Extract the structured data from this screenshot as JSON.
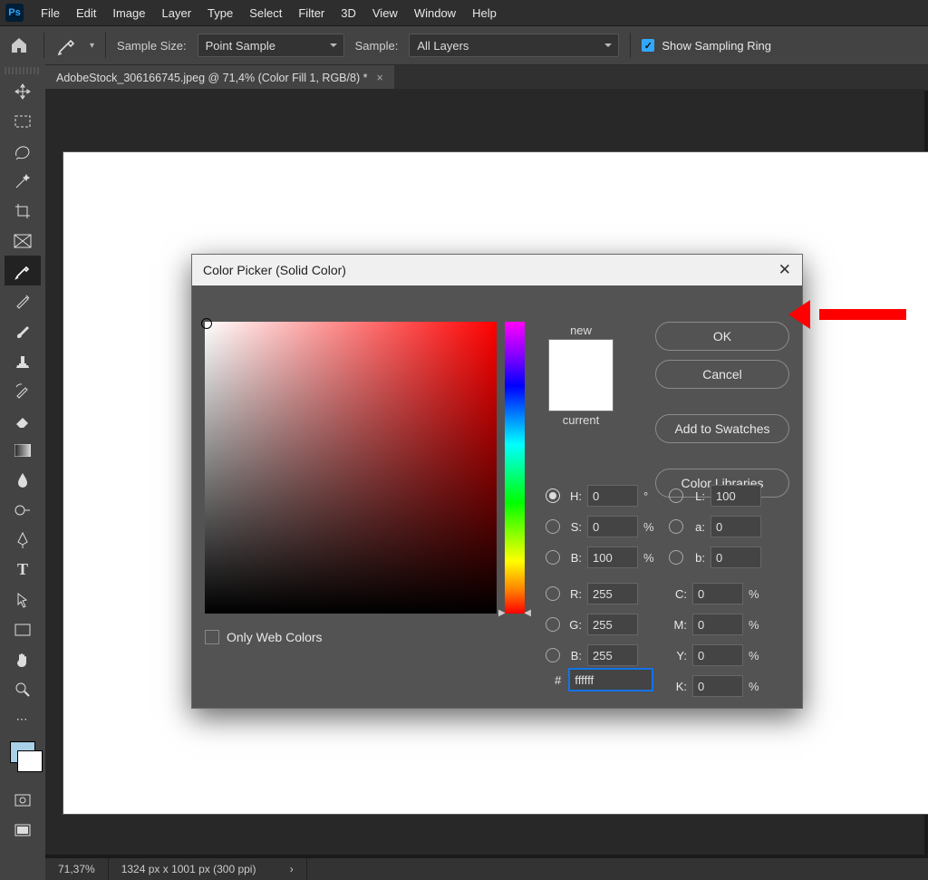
{
  "app": {
    "logo": "Ps"
  },
  "menu": [
    "File",
    "Edit",
    "Image",
    "Layer",
    "Type",
    "Select",
    "Filter",
    "3D",
    "View",
    "Window",
    "Help"
  ],
  "options": {
    "sample_size_label": "Sample Size:",
    "sample_size_value": "Point Sample",
    "sample_label": "Sample:",
    "sample_value": "All Layers",
    "ring_label": "Show Sampling Ring"
  },
  "tab": {
    "title": "AdobeStock_306166745.jpeg @ 71,4% (Color Fill 1, RGB/8) *",
    "close": "×"
  },
  "status": {
    "zoom": "71,37%",
    "docinfo": "1324 px x 1001 px (300 ppi)"
  },
  "dialog": {
    "title": "Color Picker (Solid Color)",
    "new_label": "new",
    "current_label": "current",
    "ok": "OK",
    "cancel": "Cancel",
    "add_swatch": "Add to Swatches",
    "color_libs": "Color Libraries",
    "webcolors": "Only Web Colors",
    "fields": {
      "H": {
        "label": "H:",
        "val": "0",
        "unit": "°"
      },
      "S": {
        "label": "S:",
        "val": "0",
        "unit": "%"
      },
      "Bh": {
        "label": "B:",
        "val": "100",
        "unit": "%"
      },
      "L": {
        "label": "L:",
        "val": "100"
      },
      "a": {
        "label": "a:",
        "val": "0"
      },
      "b": {
        "label": "b:",
        "val": "0"
      },
      "R": {
        "label": "R:",
        "val": "255"
      },
      "G": {
        "label": "G:",
        "val": "255"
      },
      "Bb": {
        "label": "B:",
        "val": "255"
      },
      "C": {
        "label": "C:",
        "val": "0",
        "unit": "%"
      },
      "M": {
        "label": "M:",
        "val": "0",
        "unit": "%"
      },
      "Y": {
        "label": "Y:",
        "val": "0",
        "unit": "%"
      },
      "K": {
        "label": "K:",
        "val": "0",
        "unit": "%"
      }
    },
    "hex_label": "#",
    "hex_value": "ffffff"
  }
}
